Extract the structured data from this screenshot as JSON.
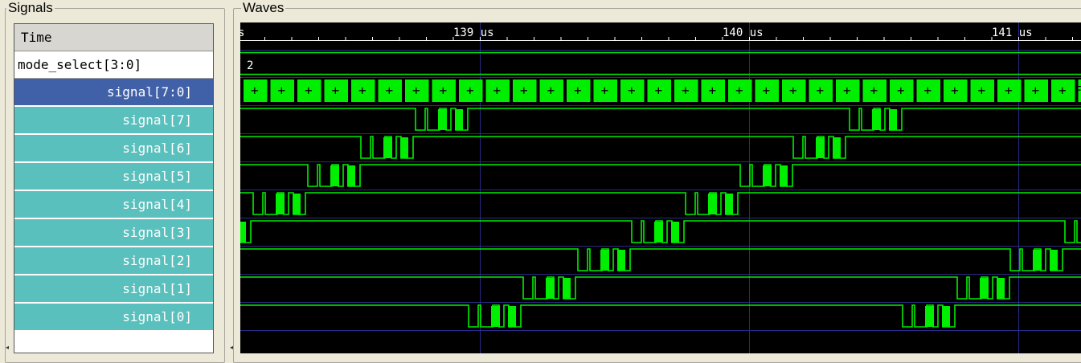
{
  "signals_panel": {
    "title": "Signals",
    "rows": [
      {
        "label": "Time",
        "style": "time"
      },
      {
        "label": "mode_select[3:0]",
        "style": "plain"
      },
      {
        "label": "signal[7:0]",
        "style": "selected"
      },
      {
        "label": "signal[7]",
        "style": "teal"
      },
      {
        "label": "signal[6]",
        "style": "teal"
      },
      {
        "label": "signal[5]",
        "style": "teal"
      },
      {
        "label": "signal[4]",
        "style": "teal"
      },
      {
        "label": "signal[3]",
        "style": "teal"
      },
      {
        "label": "signal[2]",
        "style": "teal"
      },
      {
        "label": "signal[1]",
        "style": "teal"
      },
      {
        "label": "signal[0]",
        "style": "teal"
      }
    ]
  },
  "waves_panel": {
    "title": "Waves",
    "time_labels": [
      "139 us",
      "140 us",
      "141 us"
    ],
    "left_edge_label": "s",
    "mode_select_value": "2",
    "bus_segment_label": "+",
    "bus_cutoff_label": "F"
  },
  "colors": {
    "wave_green": "#00ee00",
    "grid_blue": "#2a2a8a",
    "selected_row": "#4060a8",
    "teal_row": "#5ac0bd",
    "panel_bg": "#ECE9D8"
  }
}
